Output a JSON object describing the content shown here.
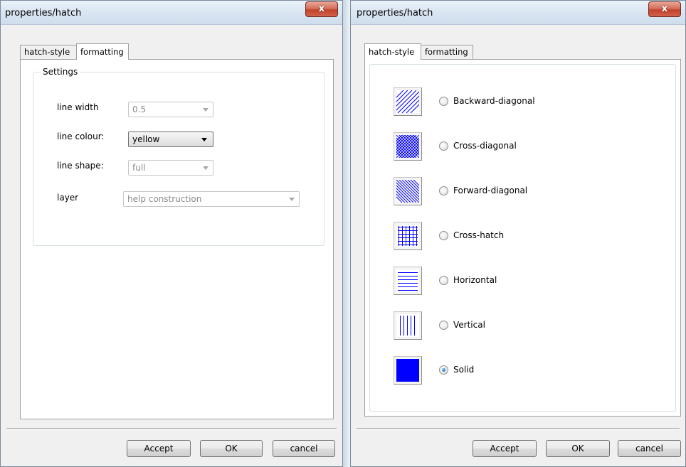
{
  "left_dialog": {
    "title": "properties/hatch",
    "close_label": "x",
    "tabs": [
      {
        "label": "hatch-style",
        "active": false
      },
      {
        "label": "formatting",
        "active": true
      }
    ],
    "group_label": "Settings",
    "fields": {
      "line_width": {
        "label": "line width",
        "value": "0.5",
        "enabled": false
      },
      "line_colour": {
        "label": "line colour:",
        "value": "yellow",
        "enabled": true
      },
      "line_shape": {
        "label": "line shape:",
        "value": "full",
        "enabled": false
      },
      "layer": {
        "label": "layer",
        "value": "help construction",
        "enabled": false
      }
    },
    "buttons": {
      "accept": "Accept",
      "ok": "OK",
      "cancel": "cancel"
    }
  },
  "right_dialog": {
    "title": "properties/hatch",
    "close_label": "x",
    "tabs": [
      {
        "label": "hatch-style",
        "active": true
      },
      {
        "label": "formatting",
        "active": false
      }
    ],
    "hatch_options": [
      {
        "label": "Backward-diagonal",
        "icon": "backward-diagonal-pattern",
        "checked": false
      },
      {
        "label": "Cross-diagonal",
        "icon": "cross-diagonal-pattern",
        "checked": false
      },
      {
        "label": "Forward-diagonal",
        "icon": "forward-diagonal-pattern",
        "checked": false
      },
      {
        "label": "Cross-hatch",
        "icon": "cross-hatch-pattern",
        "checked": false
      },
      {
        "label": "Horizontal",
        "icon": "horizontal-pattern",
        "checked": false
      },
      {
        "label": "Vertical",
        "icon": "vertical-pattern",
        "checked": false
      },
      {
        "label": "Solid",
        "icon": "solid-pattern",
        "checked": true
      }
    ],
    "buttons": {
      "accept": "Accept",
      "ok": "OK",
      "cancel": "cancel"
    }
  },
  "colors": {
    "hatch_blue": "#0000ff",
    "close_red": "#c7432c"
  }
}
